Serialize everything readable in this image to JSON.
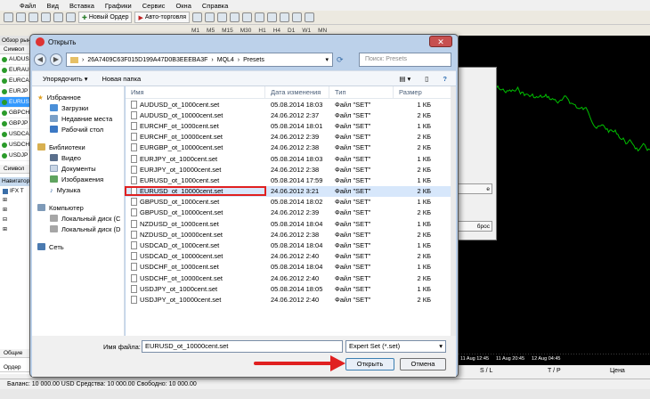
{
  "terminal": {
    "menu": [
      "Файл",
      "Вид",
      "Вставка",
      "Графики",
      "Сервис",
      "Окна",
      "Справка"
    ],
    "new_order": "Новый Ордер",
    "autotrading": "Авто-торговля",
    "timeframes": [
      "M1",
      "M5",
      "M15",
      "M30",
      "H1",
      "H4",
      "D1",
      "W1",
      "MN"
    ],
    "market_watch": {
      "title": "Обзор рын",
      "column": "Символ",
      "symbols": [
        "AUDUS",
        "EURAU",
        "EURCA",
        "EURJP",
        "EURUS",
        "GBPCH",
        "GBPJP",
        "USDCA",
        "USDCH",
        "USDJP"
      ],
      "selected": "EURUS",
      "tab": "Символ"
    },
    "navigator": {
      "title": "Навигатор",
      "items": [
        "IFX T",
        "",
        "",
        "",
        ""
      ]
    },
    "chart": {
      "axis_labels": [
        "11 Aug 12:45",
        "11 Aug 20:45",
        "12 Aug 04:45"
      ],
      "line_color": "#00c000"
    },
    "bottom_headers": [
      "S / L",
      "T / P",
      "Цена"
    ],
    "bottom_left_tab": "Общие",
    "bottom_left_row": "Ордер",
    "status": "Баланс: 10 000.00 USD  Средства: 10 000.00  Свободно: 10 000.00",
    "behind_dialog": {
      "btn1": "е",
      "btn2": "брос"
    }
  },
  "dialog": {
    "title": "Открыть",
    "close": "✕",
    "address": [
      "26A7409C63F015D199A47D0B3EEEBA3F",
      "MQL4",
      "Presets"
    ],
    "search_placeholder": "Поиск: Presets",
    "organize": "Упорядочить ▾",
    "new_folder": "Новая папка",
    "nav": {
      "favorites": "Избранное",
      "downloads": "Загрузки",
      "recent": "Недавние места",
      "desktop": "Рабочий стол",
      "libraries": "Библиотеки",
      "video": "Видео",
      "documents": "Документы",
      "images": "Изображения",
      "music": "Музыка",
      "computer": "Компьютер",
      "disk_c": "Локальный диск (С",
      "disk_d": "Локальный диск (D",
      "network": "Сеть"
    },
    "columns": {
      "name": "Имя",
      "date": "Дата изменения",
      "type": "Тип",
      "size": "Размер"
    },
    "files": [
      {
        "name": "AUDUSD_ot_1000cent.set",
        "date": "05.08.2014 18:03",
        "type": "Файл \"SET\"",
        "size": "1 КБ"
      },
      {
        "name": "AUDUSD_ot_10000cent.set",
        "date": "24.06.2012 2:37",
        "type": "Файл \"SET\"",
        "size": "2 КБ"
      },
      {
        "name": "EURCHF_ot_1000cent.set",
        "date": "05.08.2014 18:01",
        "type": "Файл \"SET\"",
        "size": "1 КБ"
      },
      {
        "name": "EURCHF_ot_10000cent.set",
        "date": "24.06.2012 2:39",
        "type": "Файл \"SET\"",
        "size": "2 КБ"
      },
      {
        "name": "EURGBP_ot_10000cent.set",
        "date": "24.06.2012 2:38",
        "type": "Файл \"SET\"",
        "size": "2 КБ"
      },
      {
        "name": "EURJPY_ot_1000cent.set",
        "date": "05.08.2014 18:03",
        "type": "Файл \"SET\"",
        "size": "1 КБ"
      },
      {
        "name": "EURJPY_ot_10000cent.set",
        "date": "24.06.2012 2:38",
        "type": "Файл \"SET\"",
        "size": "2 КБ"
      },
      {
        "name": "EURUSD_ot_1000cent.set",
        "date": "05.08.2014 17:59",
        "type": "Файл \"SET\"",
        "size": "1 КБ"
      },
      {
        "name": "EURUSD_ot_10000cent.set",
        "date": "24.06.2012 3:21",
        "type": "Файл \"SET\"",
        "size": "2 КБ"
      },
      {
        "name": "GBPUSD_ot_1000cent.set",
        "date": "05.08.2014 18:02",
        "type": "Файл \"SET\"",
        "size": "1 КБ"
      },
      {
        "name": "GBPUSD_ot_10000cent.set",
        "date": "24.06.2012 2:39",
        "type": "Файл \"SET\"",
        "size": "2 КБ"
      },
      {
        "name": "NZDUSD_ot_1000cent.set",
        "date": "05.08.2014 18:04",
        "type": "Файл \"SET\"",
        "size": "1 КБ"
      },
      {
        "name": "NZDUSD_ot_10000cent.set",
        "date": "24.06.2012 2:38",
        "type": "Файл \"SET\"",
        "size": "2 КБ"
      },
      {
        "name": "USDCAD_ot_1000cent.set",
        "date": "05.08.2014 18:04",
        "type": "Файл \"SET\"",
        "size": "1 КБ"
      },
      {
        "name": "USDCAD_ot_10000cent.set",
        "date": "24.06.2012 2:40",
        "type": "Файл \"SET\"",
        "size": "2 КБ"
      },
      {
        "name": "USDCHF_ot_1000cent.set",
        "date": "05.08.2014 18:04",
        "type": "Файл \"SET\"",
        "size": "1 КБ"
      },
      {
        "name": "USDCHF_ot_10000cent.set",
        "date": "24.06.2012 2:40",
        "type": "Файл \"SET\"",
        "size": "2 КБ"
      },
      {
        "name": "USDJPY_ot_1000cent.set",
        "date": "05.08.2014 18:05",
        "type": "Файл \"SET\"",
        "size": "1 КБ"
      },
      {
        "name": "USDJPY_ot_10000cent.set",
        "date": "24.06.2012 2:40",
        "type": "Файл \"SET\"",
        "size": "2 КБ"
      }
    ],
    "selected_file": "EURUSD_ot_10000cent.set",
    "filename_label": "Имя файла:",
    "filename_value": "EURUSD_ot_10000cent.set",
    "filetype_value": "Expert Set (*.set)",
    "open_button": "Открыть",
    "cancel_button": "Отмена",
    "highlight_color": "#e02020"
  }
}
